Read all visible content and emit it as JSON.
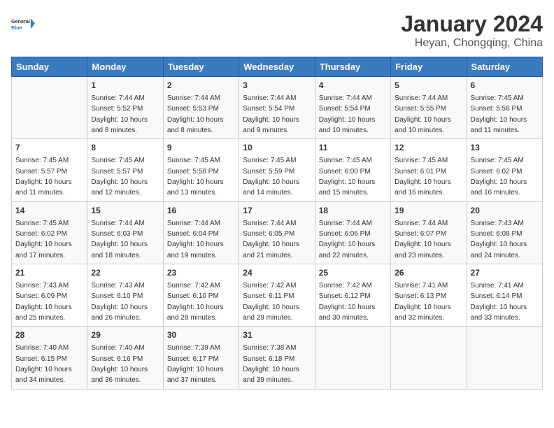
{
  "header": {
    "logo_line1": "General",
    "logo_line2": "Blue",
    "month": "January 2024",
    "location": "Heyan, Chongqing, China"
  },
  "days_of_week": [
    "Sunday",
    "Monday",
    "Tuesday",
    "Wednesday",
    "Thursday",
    "Friday",
    "Saturday"
  ],
  "weeks": [
    [
      {
        "day": "",
        "sunrise": "",
        "sunset": "",
        "daylight": ""
      },
      {
        "day": "1",
        "sunrise": "Sunrise: 7:44 AM",
        "sunset": "Sunset: 5:52 PM",
        "daylight": "Daylight: 10 hours and 8 minutes."
      },
      {
        "day": "2",
        "sunrise": "Sunrise: 7:44 AM",
        "sunset": "Sunset: 5:53 PM",
        "daylight": "Daylight: 10 hours and 8 minutes."
      },
      {
        "day": "3",
        "sunrise": "Sunrise: 7:44 AM",
        "sunset": "Sunset: 5:54 PM",
        "daylight": "Daylight: 10 hours and 9 minutes."
      },
      {
        "day": "4",
        "sunrise": "Sunrise: 7:44 AM",
        "sunset": "Sunset: 5:54 PM",
        "daylight": "Daylight: 10 hours and 10 minutes."
      },
      {
        "day": "5",
        "sunrise": "Sunrise: 7:44 AM",
        "sunset": "Sunset: 5:55 PM",
        "daylight": "Daylight: 10 hours and 10 minutes."
      },
      {
        "day": "6",
        "sunrise": "Sunrise: 7:45 AM",
        "sunset": "Sunset: 5:56 PM",
        "daylight": "Daylight: 10 hours and 11 minutes."
      }
    ],
    [
      {
        "day": "7",
        "sunrise": "Sunrise: 7:45 AM",
        "sunset": "Sunset: 5:57 PM",
        "daylight": "Daylight: 10 hours and 11 minutes."
      },
      {
        "day": "8",
        "sunrise": "Sunrise: 7:45 AM",
        "sunset": "Sunset: 5:57 PM",
        "daylight": "Daylight: 10 hours and 12 minutes."
      },
      {
        "day": "9",
        "sunrise": "Sunrise: 7:45 AM",
        "sunset": "Sunset: 5:58 PM",
        "daylight": "Daylight: 10 hours and 13 minutes."
      },
      {
        "day": "10",
        "sunrise": "Sunrise: 7:45 AM",
        "sunset": "Sunset: 5:59 PM",
        "daylight": "Daylight: 10 hours and 14 minutes."
      },
      {
        "day": "11",
        "sunrise": "Sunrise: 7:45 AM",
        "sunset": "Sunset: 6:00 PM",
        "daylight": "Daylight: 10 hours and 15 minutes."
      },
      {
        "day": "12",
        "sunrise": "Sunrise: 7:45 AM",
        "sunset": "Sunset: 6:01 PM",
        "daylight": "Daylight: 10 hours and 16 minutes."
      },
      {
        "day": "13",
        "sunrise": "Sunrise: 7:45 AM",
        "sunset": "Sunset: 6:02 PM",
        "daylight": "Daylight: 10 hours and 16 minutes."
      }
    ],
    [
      {
        "day": "14",
        "sunrise": "Sunrise: 7:45 AM",
        "sunset": "Sunset: 6:02 PM",
        "daylight": "Daylight: 10 hours and 17 minutes."
      },
      {
        "day": "15",
        "sunrise": "Sunrise: 7:44 AM",
        "sunset": "Sunset: 6:03 PM",
        "daylight": "Daylight: 10 hours and 18 minutes."
      },
      {
        "day": "16",
        "sunrise": "Sunrise: 7:44 AM",
        "sunset": "Sunset: 6:04 PM",
        "daylight": "Daylight: 10 hours and 19 minutes."
      },
      {
        "day": "17",
        "sunrise": "Sunrise: 7:44 AM",
        "sunset": "Sunset: 6:05 PM",
        "daylight": "Daylight: 10 hours and 21 minutes."
      },
      {
        "day": "18",
        "sunrise": "Sunrise: 7:44 AM",
        "sunset": "Sunset: 6:06 PM",
        "daylight": "Daylight: 10 hours and 22 minutes."
      },
      {
        "day": "19",
        "sunrise": "Sunrise: 7:44 AM",
        "sunset": "Sunset: 6:07 PM",
        "daylight": "Daylight: 10 hours and 23 minutes."
      },
      {
        "day": "20",
        "sunrise": "Sunrise: 7:43 AM",
        "sunset": "Sunset: 6:08 PM",
        "daylight": "Daylight: 10 hours and 24 minutes."
      }
    ],
    [
      {
        "day": "21",
        "sunrise": "Sunrise: 7:43 AM",
        "sunset": "Sunset: 6:09 PM",
        "daylight": "Daylight: 10 hours and 25 minutes."
      },
      {
        "day": "22",
        "sunrise": "Sunrise: 7:43 AM",
        "sunset": "Sunset: 6:10 PM",
        "daylight": "Daylight: 10 hours and 26 minutes."
      },
      {
        "day": "23",
        "sunrise": "Sunrise: 7:42 AM",
        "sunset": "Sunset: 6:10 PM",
        "daylight": "Daylight: 10 hours and 28 minutes."
      },
      {
        "day": "24",
        "sunrise": "Sunrise: 7:42 AM",
        "sunset": "Sunset: 6:11 PM",
        "daylight": "Daylight: 10 hours and 29 minutes."
      },
      {
        "day": "25",
        "sunrise": "Sunrise: 7:42 AM",
        "sunset": "Sunset: 6:12 PM",
        "daylight": "Daylight: 10 hours and 30 minutes."
      },
      {
        "day": "26",
        "sunrise": "Sunrise: 7:41 AM",
        "sunset": "Sunset: 6:13 PM",
        "daylight": "Daylight: 10 hours and 32 minutes."
      },
      {
        "day": "27",
        "sunrise": "Sunrise: 7:41 AM",
        "sunset": "Sunset: 6:14 PM",
        "daylight": "Daylight: 10 hours and 33 minutes."
      }
    ],
    [
      {
        "day": "28",
        "sunrise": "Sunrise: 7:40 AM",
        "sunset": "Sunset: 6:15 PM",
        "daylight": "Daylight: 10 hours and 34 minutes."
      },
      {
        "day": "29",
        "sunrise": "Sunrise: 7:40 AM",
        "sunset": "Sunset: 6:16 PM",
        "daylight": "Daylight: 10 hours and 36 minutes."
      },
      {
        "day": "30",
        "sunrise": "Sunrise: 7:39 AM",
        "sunset": "Sunset: 6:17 PM",
        "daylight": "Daylight: 10 hours and 37 minutes."
      },
      {
        "day": "31",
        "sunrise": "Sunrise: 7:38 AM",
        "sunset": "Sunset: 6:18 PM",
        "daylight": "Daylight: 10 hours and 39 minutes."
      },
      {
        "day": "",
        "sunrise": "",
        "sunset": "",
        "daylight": ""
      },
      {
        "day": "",
        "sunrise": "",
        "sunset": "",
        "daylight": ""
      },
      {
        "day": "",
        "sunrise": "",
        "sunset": "",
        "daylight": ""
      }
    ]
  ]
}
